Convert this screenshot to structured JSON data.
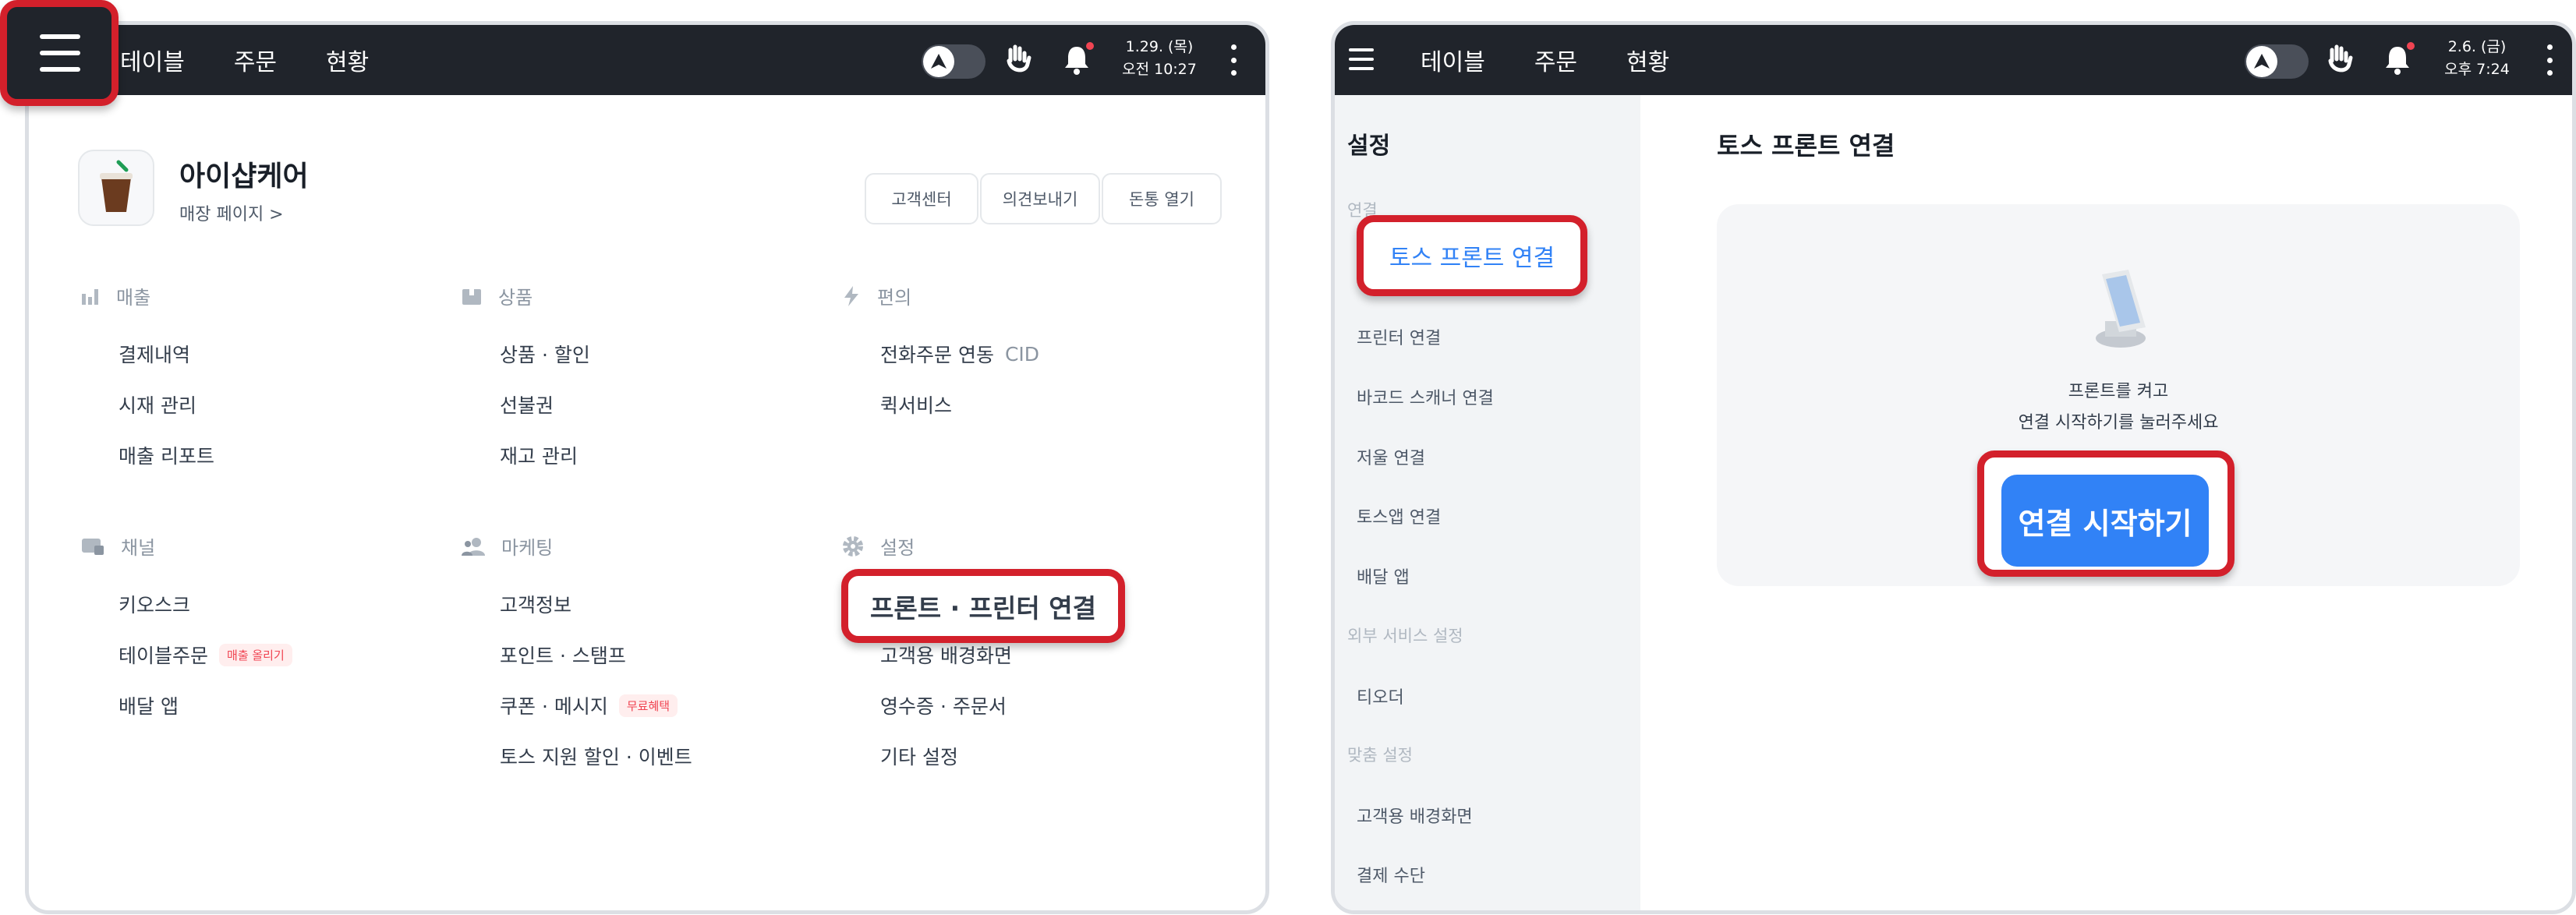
{
  "left_screen": {
    "nav": [
      "테이블",
      "주문",
      "현황"
    ],
    "date_line1": "1.29. (목)",
    "date_line2": "오전 10:27",
    "store": {
      "name": "아이샵케어",
      "subtitle": "매장 페이지 >"
    },
    "header_buttons": [
      "고객센터",
      "의견보내기",
      "돈통 열기"
    ],
    "sections": [
      {
        "title": "매출",
        "icon": "bar-chart-icon",
        "items": [
          "결제내역",
          "시재 관리",
          "매출 리포트"
        ]
      },
      {
        "title": "상품",
        "icon": "box-icon",
        "items": [
          "상품 · 할인",
          "선불권",
          "재고 관리"
        ]
      },
      {
        "title": "편의",
        "icon": "lightning-icon",
        "items": [
          "전화주문 연동",
          "퀵서비스"
        ],
        "cid_label": "CID"
      },
      {
        "title": "채널",
        "icon": "channel-icon",
        "items": [
          "키오스크",
          "테이블주문",
          "배달 앱"
        ],
        "badge": "매출 올리기"
      },
      {
        "title": "마케팅",
        "icon": "people-icon",
        "items": [
          "고객정보",
          "포인트 · 스탬프",
          "쿠폰 · 메시지",
          "토스 지원 할인 · 이벤트"
        ],
        "badge": "무료혜택"
      },
      {
        "title": "설정",
        "icon": "gear-icon",
        "items": [
          "프론트 · 프린터 연결",
          "고객용 배경화면",
          "영수증 · 주문서",
          "기타 설정"
        ]
      }
    ]
  },
  "right_screen": {
    "nav": [
      "테이블",
      "주문",
      "현황"
    ],
    "date_line1": "2.6. (금)",
    "date_line2": "오후 7:24",
    "sidebar": {
      "title": "설정",
      "groups": [
        {
          "label": "연결",
          "items": [
            "토스 프론트 연결",
            "프린터 연결",
            "바코드 스캐너 연결",
            "저울 연결",
            "토스앱 연결",
            "배달 앱"
          ]
        },
        {
          "label": "외부 서비스 설정",
          "items": [
            "티오더"
          ]
        },
        {
          "label": "맞춤 설정",
          "items": [
            "고객용 배경화면",
            "결제 수단"
          ]
        }
      ]
    },
    "main": {
      "title": "토스 프론트 연결",
      "instruction_line1": "프론트를 켜고",
      "instruction_line2": "연결 시작하기를 눌러주세요",
      "button": "연결 시작하기"
    }
  },
  "colors": {
    "topbar": "#20242b",
    "highlight": "#d3202b",
    "accent": "#3182f6",
    "sidebar_bg": "#f2f4f6"
  }
}
